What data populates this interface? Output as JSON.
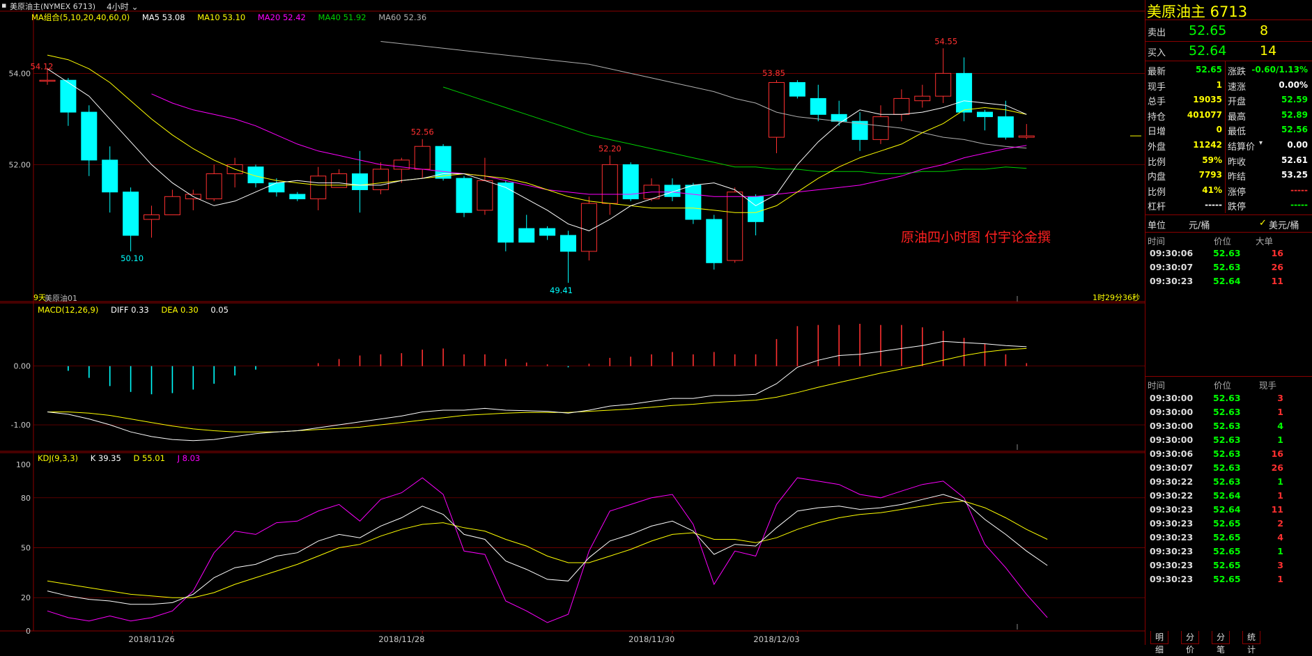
{
  "topbar": {
    "title": "美原油主(NYMEX 6713)",
    "period": "4小时"
  },
  "legends": {
    "ma": {
      "name": "MA组合(5,10,20,40,60,0)",
      "ma5": "MA5 53.08",
      "ma10": "MA10 53.10",
      "ma20": "MA20 52.42",
      "ma40": "MA40 51.92",
      "ma60": "MA60 52.36"
    },
    "macd": {
      "name": "MACD(12,26,9)",
      "diff": "DIFF 0.33",
      "dea": "DEA 0.30",
      "macd": "0.05"
    },
    "kdj": {
      "name": "KDJ(9,3,3)",
      "k": "K 39.35",
      "d": "D 55.01",
      "j": "J 8.03"
    }
  },
  "colors": {
    "up": "#ff3030",
    "down": "#00ffff",
    "ma5": "#ffffff",
    "ma10": "#ffff00",
    "ma20": "#ff00ff",
    "ma40": "#00d000",
    "ma60": "#b0b0b0",
    "grid": "#8b0000"
  },
  "annotations": {
    "high_label": "54.55",
    "left_high": "54.12",
    "low1": "50.10",
    "low2": "49.41",
    "h1": "52.56",
    "h2": "52.20",
    "h3": "53.85",
    "days": "9天",
    "contract": "美原油01",
    "countdown": "1时29分36秒",
    "watermark": "原油四小时图  付宇论金撰"
  },
  "axes": {
    "price_ticks": [
      "54.00",
      "52.00"
    ],
    "macd_ticks": [
      "0.00",
      "-1.00"
    ],
    "kdj_ticks": [
      "100",
      "80",
      "50",
      "20",
      "0"
    ],
    "dates": [
      "2018/11/26",
      "2018/11/28",
      "2018/11/30",
      "2018/12/03"
    ]
  },
  "panel": {
    "title": "美原油主  6713",
    "sell": {
      "label": "卖出",
      "price": "52.65",
      "qty": "8"
    },
    "buy": {
      "label": "买入",
      "price": "52.64",
      "qty": "14"
    },
    "stats": [
      {
        "l1": "最新",
        "v1": "52.65",
        "c1": "#00ff00",
        "l2": "涨跌",
        "v2": "-0.60/1.13%",
        "c2": "#00ff00"
      },
      {
        "l1": "现手",
        "v1": "1",
        "c1": "#ffff00",
        "l2": "速涨",
        "v2": "0.00%",
        "c2": "#ffffff"
      },
      {
        "l1": "总手",
        "v1": "19035",
        "c1": "#ffff00",
        "l2": "开盘",
        "v2": "52.59",
        "c2": "#00ff00"
      },
      {
        "l1": "持仓",
        "v1": "401077",
        "c1": "#ffff00",
        "l2": "最高",
        "v2": "52.89",
        "c2": "#00ff00"
      },
      {
        "l1": "日增",
        "v1": "0",
        "c1": "#ffff00",
        "l2": "最低",
        "v2": "52.56",
        "c2": "#00ff00"
      },
      {
        "l1": "外盘",
        "v1": "11242",
        "c1": "#ffff00",
        "l2": "结算价",
        "v2": "0.00",
        "c2": "#ffffff"
      },
      {
        "l1": "比例",
        "v1": "59%",
        "c1": "#ffff00",
        "l2": "昨收",
        "v2": "52.61",
        "c2": "#ffffff"
      },
      {
        "l1": "内盘",
        "v1": "7793",
        "c1": "#ffff00",
        "l2": "昨结",
        "v2": "53.25",
        "c2": "#ffffff"
      },
      {
        "l1": "比例",
        "v1": "41%",
        "c1": "#ffff00",
        "l2": "涨停",
        "v2": "-----",
        "c2": "#ff3030"
      },
      {
        "l1": "杠杆",
        "v1": "-----",
        "c1": "#ffffff",
        "l2": "跌停",
        "v2": "-----",
        "c2": "#00ff00"
      }
    ],
    "unit_label": "单位",
    "unit_value": "元/桶",
    "unit_toggle": "美元/桶",
    "big_header": {
      "time": "时间",
      "price": "价位",
      "vol": "大单"
    },
    "big_ticks": [
      {
        "time": "09:30:06",
        "price": "52.63",
        "vol": "16",
        "vc": "#ff3030"
      },
      {
        "time": "09:30:07",
        "price": "52.63",
        "vol": "26",
        "vc": "#ff3030"
      },
      {
        "time": "09:30:23",
        "price": "52.64",
        "vol": "11",
        "vc": "#ff3030"
      }
    ],
    "tick_header": {
      "time": "时间",
      "price": "价位",
      "vol": "现手"
    },
    "ticks": [
      {
        "time": "09:30:00",
        "price": "52.63",
        "vol": "3",
        "vc": "#ff3030"
      },
      {
        "time": "09:30:00",
        "price": "52.63",
        "vol": "1",
        "vc": "#ff3030"
      },
      {
        "time": "09:30:00",
        "price": "52.63",
        "vol": "4",
        "vc": "#00ff00"
      },
      {
        "time": "09:30:00",
        "price": "52.63",
        "vol": "1",
        "vc": "#00ff00"
      },
      {
        "time": "09:30:06",
        "price": "52.63",
        "vol": "16",
        "vc": "#ff3030"
      },
      {
        "time": "09:30:07",
        "price": "52.63",
        "vol": "26",
        "vc": "#ff3030"
      },
      {
        "time": "09:30:22",
        "price": "52.63",
        "vol": "1",
        "vc": "#00ff00"
      },
      {
        "time": "09:30:22",
        "price": "52.64",
        "vol": "1",
        "vc": "#ff3030"
      },
      {
        "time": "09:30:23",
        "price": "52.64",
        "vol": "11",
        "vc": "#ff3030"
      },
      {
        "time": "09:30:23",
        "price": "52.65",
        "vol": "2",
        "vc": "#ff3030"
      },
      {
        "time": "09:30:23",
        "price": "52.65",
        "vol": "4",
        "vc": "#ff3030"
      },
      {
        "time": "09:30:23",
        "price": "52.65",
        "vol": "1",
        "vc": "#00ff00"
      },
      {
        "time": "09:30:23",
        "price": "52.65",
        "vol": "3",
        "vc": "#ff3030"
      },
      {
        "time": "09:30:23",
        "price": "52.65",
        "vol": "1",
        "vc": "#ff3030"
      }
    ],
    "tabs": [
      "明细",
      "分价",
      "分笔",
      "统计"
    ]
  },
  "chart_data": {
    "type": "candlestick",
    "price_range": [
      49.0,
      55.15
    ],
    "candles": [
      [
        53.85,
        53.85,
        54.12,
        53.75
      ],
      [
        53.85,
        53.15,
        53.9,
        52.85
      ],
      [
        53.15,
        52.1,
        53.3,
        51.75
      ],
      [
        52.1,
        51.4,
        52.4,
        50.95
      ],
      [
        51.4,
        50.45,
        51.5,
        50.1
      ],
      [
        50.8,
        50.9,
        51.1,
        50.4
      ],
      [
        50.9,
        51.3,
        51.45,
        50.9
      ],
      [
        51.25,
        51.35,
        51.45,
        51.0
      ],
      [
        51.25,
        51.8,
        52.0,
        51.2
      ],
      [
        51.8,
        52.0,
        52.15,
        51.5
      ],
      [
        51.95,
        51.6,
        52.0,
        51.5
      ],
      [
        51.6,
        51.4,
        51.7,
        51.3
      ],
      [
        51.35,
        51.25,
        51.4,
        51.2
      ],
      [
        51.25,
        51.75,
        51.95,
        51.0
      ],
      [
        51.5,
        51.8,
        51.9,
        51.5
      ],
      [
        51.8,
        51.45,
        52.3,
        50.95
      ],
      [
        51.45,
        51.9,
        52.05,
        51.35
      ],
      [
        51.9,
        52.1,
        52.15,
        51.6
      ],
      [
        51.9,
        52.4,
        52.56,
        51.7
      ],
      [
        52.4,
        51.7,
        52.45,
        51.65
      ],
      [
        51.7,
        50.95,
        51.75,
        50.85
      ],
      [
        51.0,
        51.65,
        52.15,
        50.9
      ],
      [
        51.6,
        50.3,
        51.65,
        50.1
      ],
      [
        50.6,
        50.3,
        50.9,
        50.3
      ],
      [
        50.6,
        50.45,
        50.65,
        50.35
      ],
      [
        50.45,
        50.1,
        50.55,
        49.41
      ],
      [
        50.1,
        51.15,
        51.3,
        49.9
      ],
      [
        51.15,
        52.0,
        52.2,
        50.9
      ],
      [
        52.0,
        51.25,
        52.05,
        51.2
      ],
      [
        51.25,
        51.55,
        51.7,
        51.2
      ],
      [
        51.55,
        51.3,
        51.7,
        51.2
      ],
      [
        51.55,
        50.8,
        51.6,
        50.7
      ],
      [
        50.8,
        49.85,
        50.9,
        49.7
      ],
      [
        49.9,
        51.4,
        51.5,
        49.85
      ],
      [
        51.3,
        50.75,
        51.35,
        50.45
      ],
      [
        52.6,
        53.8,
        53.85,
        52.25
      ],
      [
        53.8,
        53.5,
        53.85,
        53.45
      ],
      [
        53.45,
        53.1,
        53.75,
        52.95
      ],
      [
        53.1,
        52.95,
        53.4,
        52.85
      ],
      [
        52.95,
        52.55,
        53.15,
        52.3
      ],
      [
        52.55,
        53.05,
        53.3,
        52.45
      ],
      [
        53.1,
        53.45,
        53.65,
        52.95
      ],
      [
        53.4,
        53.5,
        53.75,
        53.25
      ],
      [
        53.5,
        54.0,
        54.55,
        53.35
      ],
      [
        54.0,
        53.15,
        54.35,
        52.95
      ],
      [
        53.15,
        53.05,
        53.2,
        52.75
      ],
      [
        53.05,
        52.6,
        53.4,
        52.55
      ],
      [
        52.6,
        52.63,
        52.89,
        52.56
      ]
    ],
    "ma5": [
      54.1,
      53.8,
      53.5,
      53.0,
      52.5,
      52.0,
      51.6,
      51.3,
      51.1,
      51.2,
      51.4,
      51.6,
      51.65,
      51.6,
      51.6,
      51.55,
      51.55,
      51.65,
      51.7,
      51.8,
      51.8,
      51.65,
      51.5,
      51.25,
      51.0,
      50.7,
      50.55,
      50.8,
      51.1,
      51.25,
      51.4,
      51.55,
      51.6,
      51.45,
      51.1,
      51.35,
      52.0,
      52.5,
      52.9,
      53.2,
      53.1,
      53.1,
      53.15,
      53.25,
      53.4,
      53.35,
      53.3,
      53.1
    ],
    "ma10": [
      54.4,
      54.3,
      54.1,
      53.8,
      53.4,
      53.0,
      52.65,
      52.35,
      52.1,
      51.9,
      51.75,
      51.65,
      51.6,
      51.55,
      51.55,
      51.55,
      51.6,
      51.65,
      51.7,
      51.75,
      51.8,
      51.75,
      51.7,
      51.6,
      51.45,
      51.3,
      51.2,
      51.15,
      51.1,
      51.05,
      51.05,
      51.05,
      51.0,
      50.95,
      50.95,
      51.1,
      51.4,
      51.7,
      51.95,
      52.15,
      52.3,
      52.45,
      52.7,
      52.9,
      53.2,
      53.25,
      53.2,
      53.1
    ],
    "ma20": [
      null,
      null,
      null,
      null,
      null,
      53.55,
      53.35,
      53.2,
      53.1,
      53.0,
      52.85,
      52.65,
      52.45,
      52.3,
      52.2,
      52.1,
      52.0,
      51.95,
      51.9,
      51.85,
      51.8,
      51.75,
      51.65,
      51.55,
      51.45,
      51.4,
      51.35,
      51.35,
      51.35,
      51.4,
      51.4,
      51.35,
      51.3,
      51.3,
      51.3,
      51.35,
      51.4,
      51.45,
      51.5,
      51.55,
      51.65,
      51.75,
      51.9,
      52.0,
      52.15,
      52.25,
      52.35,
      52.42
    ],
    "ma40": [
      null,
      null,
      null,
      null,
      null,
      null,
      null,
      null,
      null,
      null,
      null,
      null,
      null,
      null,
      null,
      null,
      null,
      null,
      null,
      53.7,
      53.55,
      53.4,
      53.25,
      53.1,
      52.95,
      52.8,
      52.65,
      52.55,
      52.45,
      52.35,
      52.25,
      52.15,
      52.05,
      51.95,
      51.95,
      51.9,
      51.9,
      51.85,
      51.85,
      51.85,
      51.8,
      51.8,
      51.85,
      51.85,
      51.9,
      51.9,
      51.95,
      51.92
    ],
    "ma60": [
      null,
      null,
      null,
      null,
      null,
      null,
      null,
      null,
      null,
      null,
      null,
      null,
      null,
      null,
      null,
      null,
      54.7,
      54.65,
      54.6,
      54.55,
      54.5,
      54.45,
      54.4,
      54.35,
      54.3,
      54.25,
      54.2,
      54.1,
      54.0,
      53.9,
      53.8,
      53.7,
      53.6,
      53.45,
      53.35,
      53.15,
      53.05,
      53.0,
      52.95,
      52.9,
      52.85,
      52.8,
      52.7,
      52.6,
      52.55,
      52.45,
      52.4,
      52.36
    ],
    "macd_range": [
      -1.45,
      0.85
    ],
    "diff": [
      -0.78,
      -0.82,
      -0.9,
      -1.0,
      -1.12,
      -1.2,
      -1.25,
      -1.27,
      -1.25,
      -1.2,
      -1.15,
      -1.12,
      -1.1,
      -1.05,
      -1.0,
      -0.95,
      -0.9,
      -0.85,
      -0.78,
      -0.75,
      -0.75,
      -0.72,
      -0.75,
      -0.76,
      -0.77,
      -0.8,
      -0.75,
      -0.68,
      -0.65,
      -0.6,
      -0.55,
      -0.55,
      -0.5,
      -0.5,
      -0.48,
      -0.3,
      -0.02,
      0.1,
      0.18,
      0.2,
      0.25,
      0.3,
      0.35,
      0.42,
      0.4,
      0.38,
      0.35,
      0.33
    ],
    "dea": [
      -0.78,
      -0.78,
      -0.8,
      -0.84,
      -0.9,
      -0.96,
      -1.02,
      -1.07,
      -1.1,
      -1.12,
      -1.12,
      -1.12,
      -1.1,
      -1.08,
      -1.06,
      -1.04,
      -1.0,
      -0.96,
      -0.92,
      -0.88,
      -0.84,
      -0.82,
      -0.8,
      -0.79,
      -0.79,
      -0.79,
      -0.77,
      -0.75,
      -0.73,
      -0.7,
      -0.67,
      -0.65,
      -0.62,
      -0.6,
      -0.58,
      -0.53,
      -0.45,
      -0.36,
      -0.28,
      -0.2,
      -0.12,
      -0.05,
      0.02,
      0.1,
      0.18,
      0.24,
      0.28,
      0.3
    ],
    "hist": [
      0,
      -0.08,
      -0.2,
      -0.34,
      -0.44,
      -0.48,
      -0.46,
      -0.4,
      -0.3,
      -0.16,
      -0.06,
      0,
      0,
      0.05,
      0.12,
      0.18,
      0.2,
      0.22,
      0.28,
      0.3,
      0.2,
      0.2,
      0.12,
      0.06,
      0.03,
      -0.02,
      0.04,
      0.14,
      0.16,
      0.2,
      0.24,
      0.2,
      0.24,
      0.2,
      0.2,
      0.46,
      0.68,
      0.7,
      0.7,
      0.72,
      0.7,
      0.7,
      0.66,
      0.6,
      0.48,
      0.38,
      0.2,
      0.05
    ],
    "kdj_range": [
      0,
      100
    ],
    "k": [
      24,
      21,
      19,
      18,
      16,
      16,
      17,
      22,
      32,
      38,
      40,
      45,
      47,
      54,
      58,
      56,
      63,
      68,
      75,
      70,
      58,
      55,
      42,
      37,
      31,
      30,
      44,
      54,
      58,
      63,
      66,
      60,
      46,
      52,
      51,
      62,
      72,
      74,
      75,
      73,
      74,
      76,
      79,
      82,
      78,
      67,
      58,
      48,
      39.35
    ],
    "d": [
      30,
      28,
      26,
      24,
      22,
      21,
      20,
      20,
      23,
      28,
      32,
      36,
      40,
      45,
      50,
      52,
      57,
      61,
      64,
      65,
      62,
      60,
      55,
      51,
      45,
      41,
      41,
      45,
      49,
      54,
      58,
      59,
      55,
      55,
      53,
      56,
      61,
      65,
      68,
      70,
      71,
      73,
      75,
      77,
      78,
      74,
      68,
      61,
      55.01
    ],
    "j": [
      12,
      8,
      6,
      9,
      6,
      8,
      12,
      24,
      47,
      60,
      58,
      65,
      66,
      72,
      76,
      66,
      79,
      83,
      92,
      82,
      48,
      46,
      18,
      12,
      5,
      10,
      48,
      72,
      76,
      80,
      82,
      64,
      28,
      48,
      45,
      76,
      92,
      90,
      88,
      82,
      80,
      84,
      88,
      90,
      80,
      52,
      38,
      22,
      8.03
    ]
  }
}
